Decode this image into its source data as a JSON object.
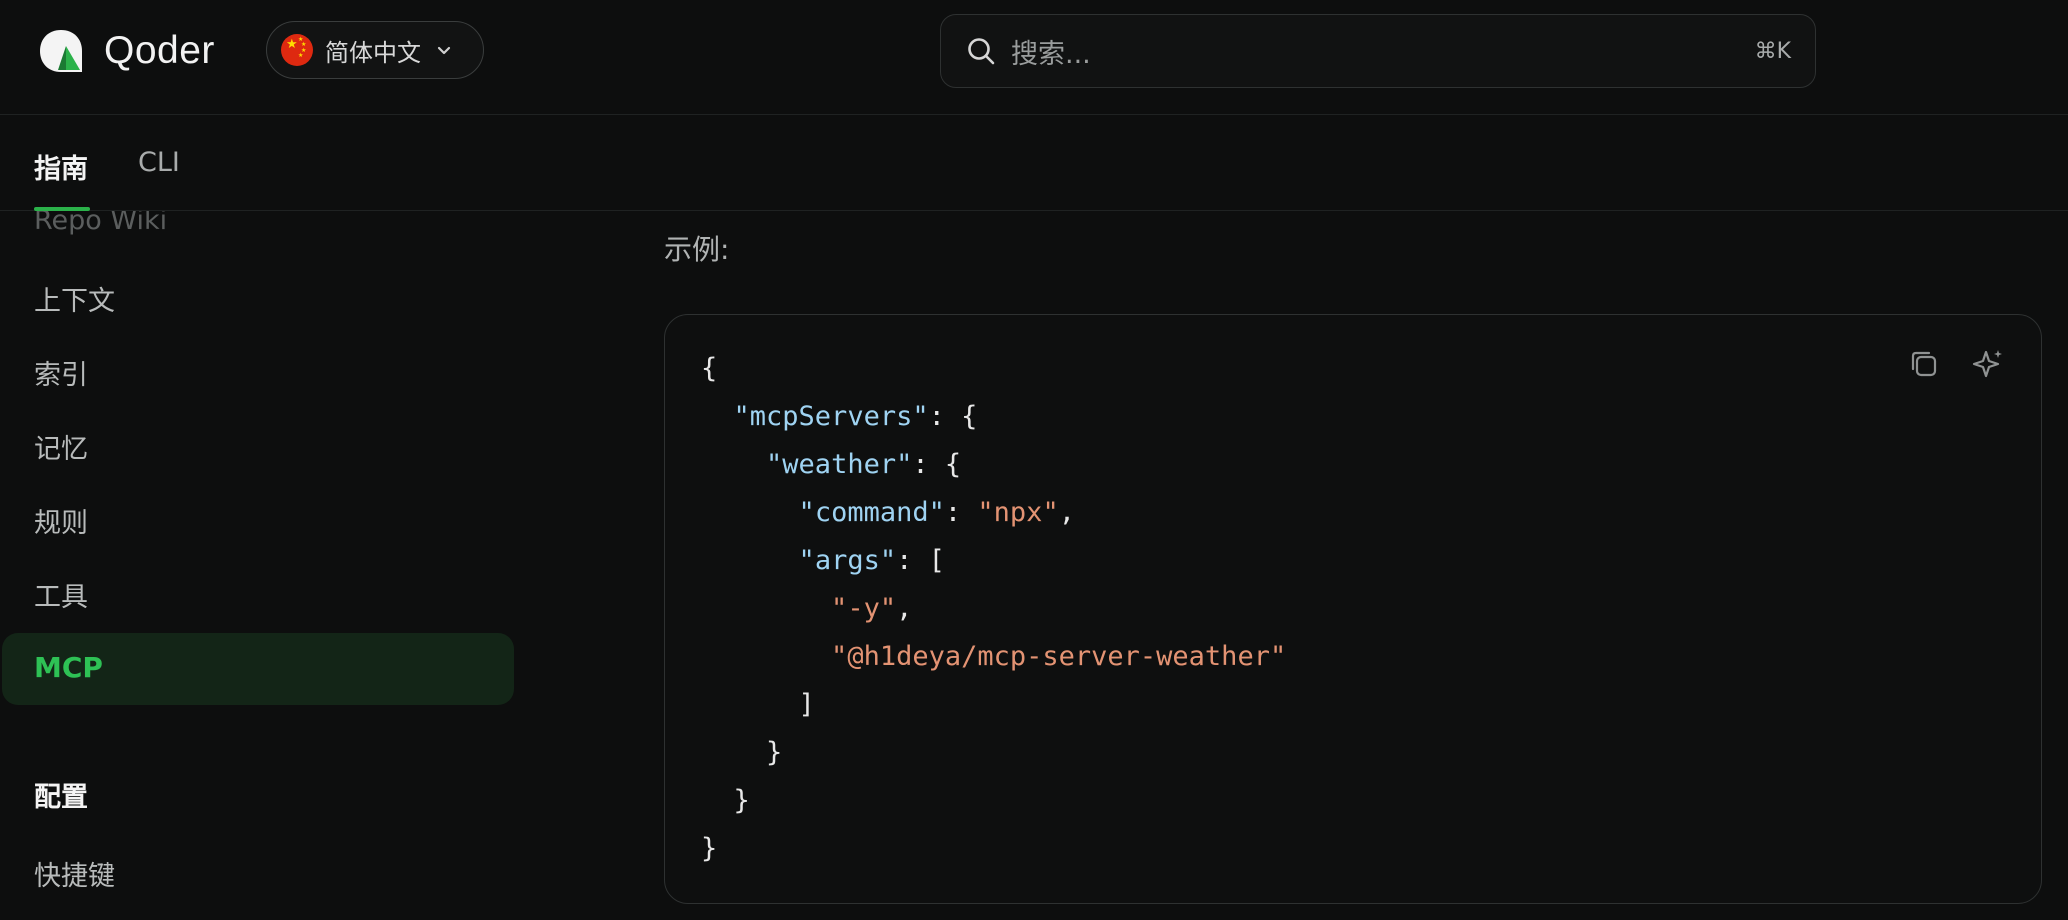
{
  "header": {
    "brand": "Qoder",
    "language": "简体中文",
    "search": {
      "placeholder": "搜索...",
      "shortcut": "⌘K"
    }
  },
  "tabs": [
    {
      "label": "指南",
      "active": true
    },
    {
      "label": "CLI",
      "active": false
    }
  ],
  "sidebar": {
    "items": [
      {
        "label": "Repo Wiki"
      },
      {
        "label": "上下文"
      },
      {
        "label": "索引"
      },
      {
        "label": "记忆"
      },
      {
        "label": "规则"
      },
      {
        "label": "工具"
      },
      {
        "label": "MCP",
        "active": true
      }
    ],
    "section": {
      "title": "配置",
      "items": [
        {
          "label": "快捷键"
        }
      ]
    }
  },
  "content": {
    "example_label": "示例:",
    "code": {
      "root_key": "mcpServers",
      "server_key": "weather",
      "command_key": "command",
      "command_value": "npx",
      "args_key": "args",
      "args": [
        "-y",
        "@h1deya/mcp-server-weather"
      ]
    }
  },
  "colors": {
    "accent": "#2bb24a",
    "json_key": "#9fd3f2",
    "json_string": "#e39373"
  }
}
